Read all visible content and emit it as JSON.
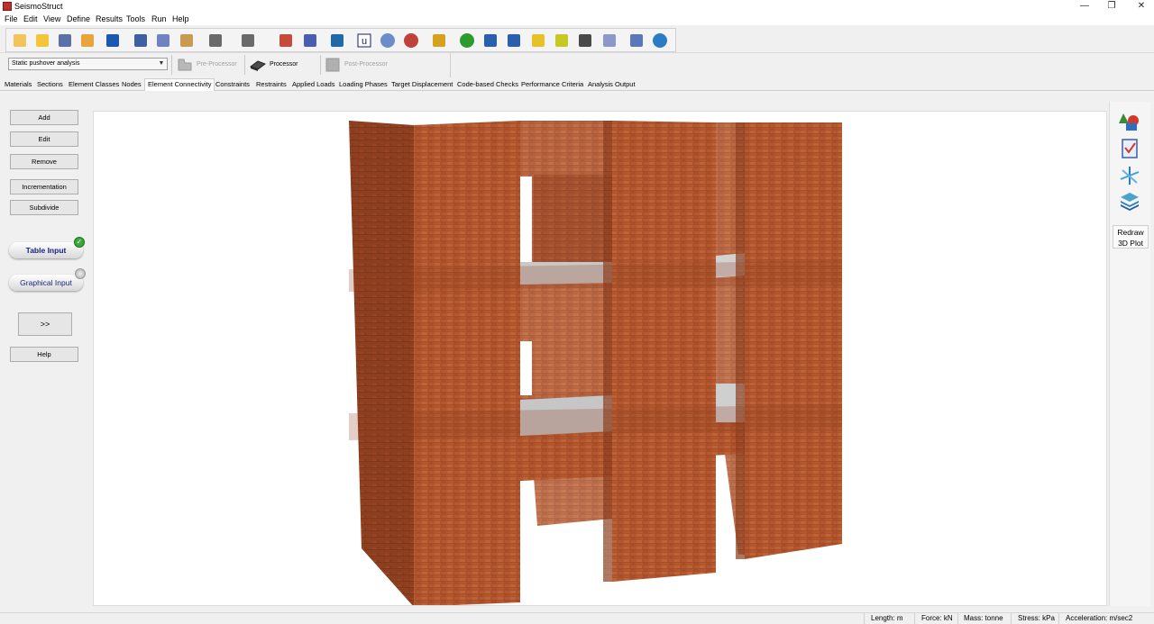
{
  "window": {
    "title": "SeismoStruct",
    "controls": [
      "—",
      "❐",
      "✕"
    ]
  },
  "menu": [
    "File",
    "Edit",
    "View",
    "Define",
    "Results",
    "Tools",
    "Run",
    "Help"
  ],
  "toolbar": {
    "buttons": [
      {
        "name": "new-file-icon",
        "color": "#f2c55a"
      },
      {
        "name": "open-folder-icon",
        "color": "#f3c63a"
      },
      {
        "name": "database-icon",
        "color": "#5b6fa8"
      },
      {
        "name": "wizard-icon",
        "color": "#e8a53b"
      },
      {
        "name": "save-icon",
        "color": "#1c57b0"
      },
      {
        "name": "print-icon",
        "color": "#3f5fa3"
      },
      {
        "name": "copy-icon",
        "color": "#6f82c1"
      },
      {
        "name": "paste-icon",
        "color": "#c89a52"
      },
      {
        "name": "undo-icon",
        "color": "#6a6a6a"
      },
      {
        "name": "redo-icon",
        "color": "#6a6a6a"
      },
      {
        "name": "export-icon",
        "color": "#c44a3c"
      },
      {
        "name": "import-icon",
        "color": "#4a5fb0"
      },
      {
        "name": "network-icon",
        "color": "#1f6aa8"
      },
      {
        "name": "units-icon",
        "color": "#1a1a7a"
      },
      {
        "name": "gear-icon",
        "color": "#6b8ec9"
      },
      {
        "name": "settings-gear-icon",
        "color": "#c0413a"
      },
      {
        "name": "ruler-pencil-icon",
        "color": "#d6a21e"
      },
      {
        "name": "help-icon",
        "color": "#2d9a2d"
      },
      {
        "name": "book-icon",
        "color": "#2a5fb0"
      },
      {
        "name": "books-icon",
        "color": "#2a5fb0"
      },
      {
        "name": "folder-icon",
        "color": "#e6c12a"
      },
      {
        "name": "folder-open-icon",
        "color": "#c6c922"
      },
      {
        "name": "film-icon",
        "color": "#4a4a4a"
      },
      {
        "name": "link-icon",
        "color": "#8c98c8"
      },
      {
        "name": "edit-icon",
        "color": "#5a78b8"
      },
      {
        "name": "globe-icon",
        "color": "#2b7cc2"
      }
    ]
  },
  "analysis": {
    "type": "Static pushover analysis",
    "pre_processor": "Pre-Processor",
    "processor": "Processor",
    "post_processor": "Post-Processor"
  },
  "tabs": [
    "Materials",
    "Sections",
    "Element Classes",
    "Nodes",
    "Element Connectivity",
    "Constraints",
    "Restraints",
    "Applied Loads",
    "Loading Phases",
    "Target Displacement",
    "Code-based Checks",
    "Performance Criteria",
    "Analysis Output"
  ],
  "active_tab": "Element Connectivity",
  "sidebar": {
    "add": "Add",
    "edit": "Edit",
    "remove": "Remove",
    "incrementation": "Incrementation",
    "subdivide": "Subdivide",
    "table_input": "Table Input",
    "graphical_input": "Graphical Input",
    "next": ">>",
    "help": "Help"
  },
  "right_panel": {
    "icons": [
      "shapes-icon",
      "checklist-icon",
      "axes-icon",
      "layers-icon"
    ],
    "redraw_line1": "Redraw",
    "redraw_line2": "3D Plot"
  },
  "status": {
    "length": "Length: m",
    "force": "Force: kN",
    "mass": "Mass: tonne",
    "stress": "Stress: kPa",
    "acceleration": "Acceleration: m/sec2"
  },
  "colors": {
    "brick": "#b5582f",
    "brick_dark": "#8e3f1f",
    "brick_light": "#c46a3c",
    "slab": "#c8c8c8"
  }
}
